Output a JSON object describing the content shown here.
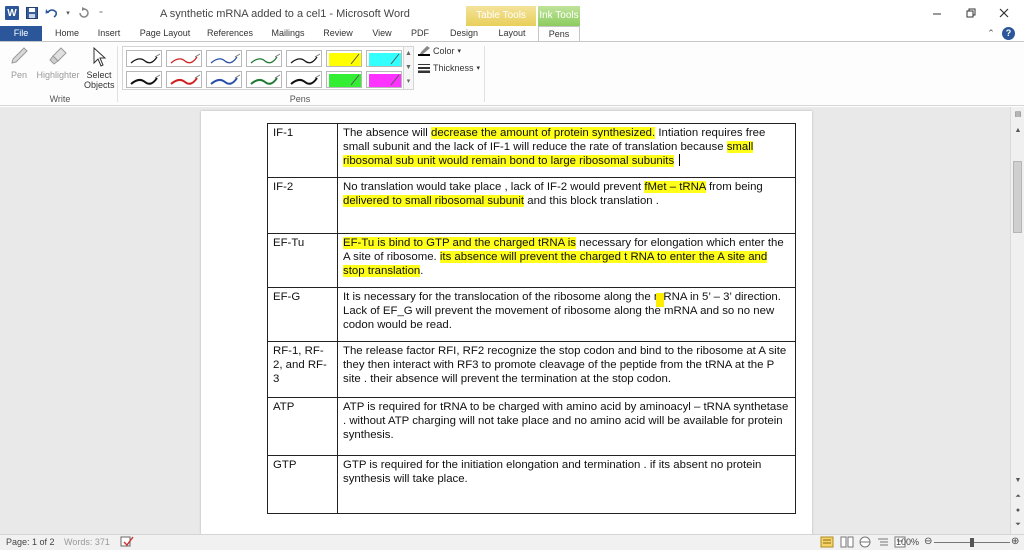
{
  "app": {
    "title": "A synthetic mRNA added to a cel1 - Microsoft Word",
    "undo_icon": "undo-icon",
    "redo_icon": "redo-icon"
  },
  "tabs": {
    "file": "File",
    "home": "Home",
    "insert": "Insert",
    "page_layout": "Page Layout",
    "references": "References",
    "mailings": "Mailings",
    "review": "Review",
    "view": "View",
    "pdf": "PDF",
    "design": "Design",
    "layout": "Layout",
    "pens": "Pens"
  },
  "context_groups": {
    "table_tools": "Table Tools",
    "ink_tools": "Ink Tools"
  },
  "ribbon": {
    "pen": "Pen",
    "highlighter": "Highlighter",
    "select_objects": "Select Objects",
    "write_group": "Write",
    "pens_group": "Pens",
    "color": "Color",
    "thickness": "Thickness"
  },
  "colors": {
    "accent": "#2b579a",
    "highlight": "#ffff1a",
    "pen_black": "#111111",
    "pen_red": "#d02020",
    "pen_blue": "#2a4fa8",
    "pen_green": "#1f7a32",
    "hl_yellow": "#ffff00",
    "hl_green": "#33ee33",
    "hl_cyan": "#33ffff",
    "hl_magenta": "#ff33ff"
  },
  "table": {
    "rows": [
      {
        "label": "IF-1",
        "text_a": "The absence will ",
        "hl_1": "decrease the amount of protein synthesized.",
        "text_b": " Intiation requires free small subunit and the lack of IF-1 will reduce the rate of translation because ",
        "hl_2": "small ribosomal sub unit would remain bond to large ribosomal subunits",
        "text_c": " "
      },
      {
        "label": "IF-2",
        "text_a": "No translation would take place , lack of IF-2 would prevent ",
        "hl_1": "fMet – tRNA",
        "text_b": " from being ",
        "hl_2": "delivered to small ribosomal subunit",
        "text_c": " and this block translation ."
      },
      {
        "label": "EF-Tu",
        "text_a": "",
        "hl_1": "EF-Tu  is bind to GTP and the charged tRNA is",
        "text_b": " necessary for elongation which enter the A site of ribosome. ",
        "hl_2": "its absence will prevent the charged t RNA to enter the A site and stop translation",
        "text_c": "."
      },
      {
        "label": "EF-G",
        "text": "It is necessary for the translocation of the ribosome along the mRNA in 5’ – 3’ direction. Lack of EF_G will prevent the movement of ribosome along the mRNA and so no new codon would be read."
      },
      {
        "label": "RF-1, RF-2, and RF-3",
        "text": "The release factor RFI, RF2 recognize the stop codon and bind to the ribosome at A site they then interact with RF3 to promote cleavage of the peptide from the tRNA at the P site . their absence will prevent the termination at the stop codon."
      },
      {
        "label": "ATP",
        "text": "ATP is required for tRNA to be charged with amino  acid by aminoacyl – tRNA synthetase .  without ATP charging will not take place and no amino acid will be available for protein synthesis."
      },
      {
        "label": "GTP",
        "text": "GTP is required for the initiation elongation and termination . if its absent no protein synthesis will take place."
      }
    ]
  },
  "status": {
    "page": "Page: 1 of 2",
    "words": "Words: 371",
    "zoom": "100%",
    "zoom_fraction": 0.5
  }
}
